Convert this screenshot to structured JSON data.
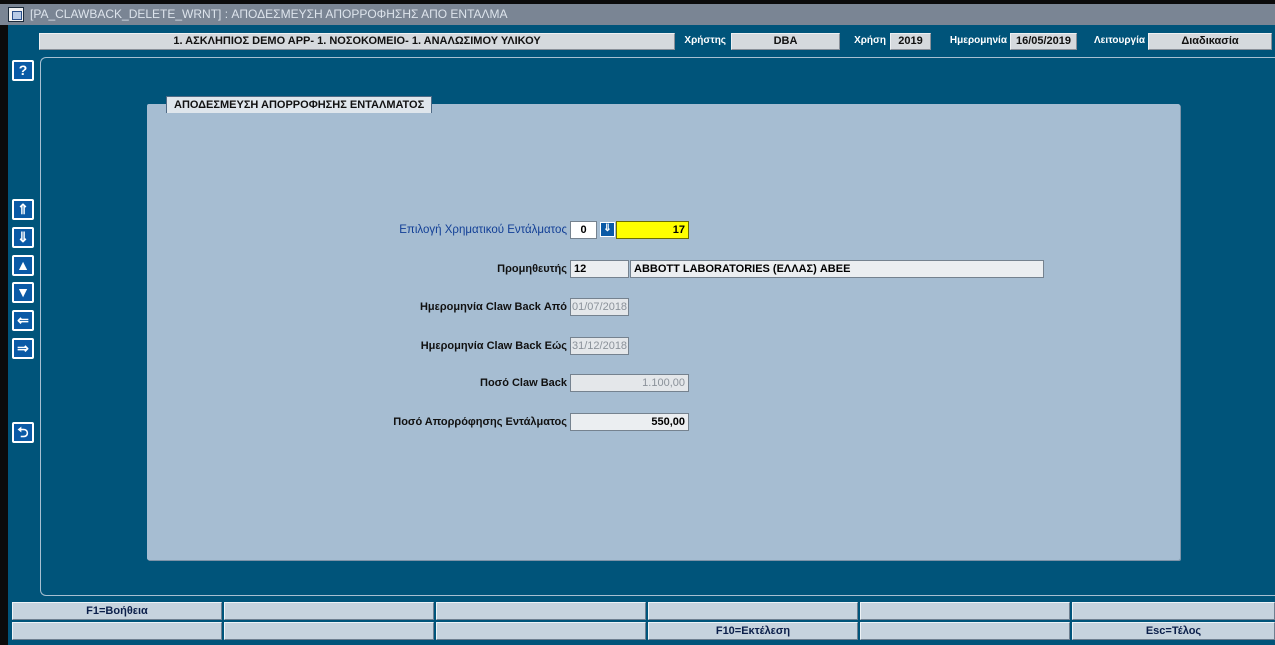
{
  "window": {
    "title": "[PA_CLAWBACK_DELETE_WRNT]  :  ΑΠΟΔΕΣΜΕΥΣΗ ΑΠΟΡΡΟΦΗΣΗΣ ΑΠΟ ΕΝΤΑΛΜΑ"
  },
  "header": {
    "company": "1. ΑΣΚΛΗΠΙΟΣ DEMO APP- 1. ΝΟΣΟΚΟΜΕΙΟ- 1. ΑΝΑΛΩΣΙΜΟΥ ΥΛΙΚΟΥ",
    "user_label": "Χρήστης",
    "user_value": "DBA",
    "year_label": "Χρήση",
    "year_value": "2019",
    "date_label": "Ημερομηνία",
    "date_value": "16/05/2019",
    "function_label": "Λειτουργία",
    "function_value": "Διαδικασία"
  },
  "sidebar": {
    "help": "?",
    "first": "⇑",
    "last": "⇓",
    "prev": "▲",
    "next": "▼",
    "back": "⇐",
    "forward": "⇒",
    "exit": "⮌"
  },
  "panel": {
    "title": "ΑΠΟΔΕΣΜΕΥΣΗ ΑΠΟΡΡΟΦΗΣΗΣ ΕΝΤΑΛΜΑΤΟΣ"
  },
  "form": {
    "warrant_label": "Επιλογή Χρηματικού Εντάλματος",
    "warrant_series": "0",
    "warrant_number": "17",
    "supplier_label": "Προμηθευτής",
    "supplier_code": "12",
    "supplier_name": "ABBOTT LABORATORIES (ΕΛΛΑΣ) ΑΒΕΕ",
    "date_from_label": "Ημερομηνία Claw Back Από",
    "date_from": "01/07/2018",
    "date_to_label": "Ημερομηνία Claw Back Εώς",
    "date_to": "31/12/2018",
    "amount_label": "Ποσό Claw Back",
    "amount": "1.100,00",
    "absorb_label": "Ποσό Απορρόφησης Εντάλματος",
    "absorb_amount": "550,00"
  },
  "fkeys": {
    "row1": [
      "F1=Βοήθεια",
      "",
      "",
      "",
      "",
      ""
    ],
    "row2": [
      "",
      "",
      "",
      "F10=Εκτέλεση",
      "",
      "Esc=Τέλος"
    ]
  }
}
